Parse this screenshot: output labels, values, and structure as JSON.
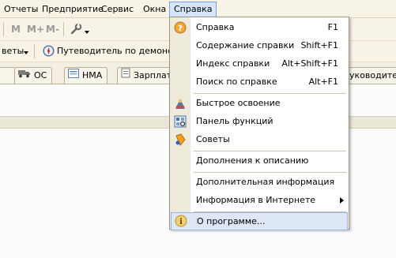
{
  "menubar": {
    "items": [
      "Отчеты",
      "Предприятие",
      "Сервис",
      "Окна",
      "Справка"
    ]
  },
  "toolbar1": {
    "buttons": [
      "M",
      "M+",
      "M-"
    ]
  },
  "toolbar2": {
    "left_label": "веты",
    "guide_label": "Путеводитель по демонстра"
  },
  "tabs": [
    "ОС",
    "НМА",
    "Зарплата",
    "уководителе"
  ],
  "help_menu": {
    "items": [
      {
        "label": "Справка",
        "shortcut": "F1",
        "icon": "help-question-icon"
      },
      {
        "label": "Содержание справки",
        "shortcut": "Shift+F1"
      },
      {
        "label": "Индекс справки",
        "shortcut": "Alt+Shift+F1"
      },
      {
        "label": "Поиск по справке",
        "shortcut": "Alt+F1"
      },
      {
        "label": "Быстрое освоение",
        "icon": "quick-learning-icon"
      },
      {
        "label": "Панель функций",
        "icon": "function-panel-icon"
      },
      {
        "label": "Советы",
        "icon": "tips-icon"
      },
      {
        "label": "Дополнения к описанию"
      },
      {
        "label": "Дополнительная информация"
      },
      {
        "label": "Информация в Интернете"
      },
      {
        "label": "О программе...",
        "icon": "info-icon"
      }
    ]
  },
  "colors": {
    "menubar_bg": "#f7f3e6",
    "active_menu": "#d7e5fb",
    "highlight": "#dde7f8"
  }
}
